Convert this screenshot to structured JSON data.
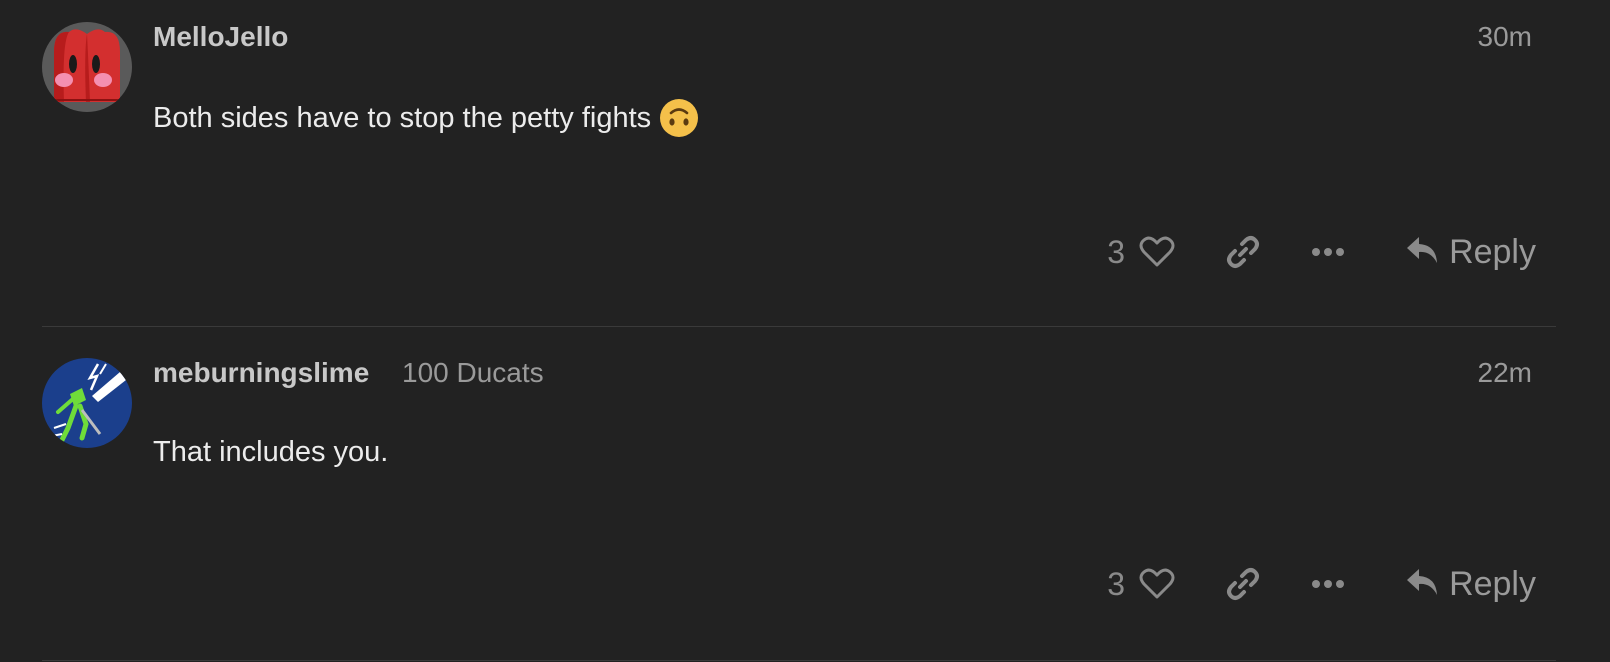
{
  "posts": [
    {
      "username": "MelloJello",
      "flair": "",
      "timestamp": "30m",
      "body": "Both sides have to stop the petty fights",
      "emoji": "upside-down-face",
      "like_count": "3",
      "reply_label": "Reply",
      "avatar_colors": {
        "background": "#5a5a5a",
        "figure": "#d32f2f",
        "cheeks": "#f48fb1"
      }
    },
    {
      "username": "meburningslime",
      "flair": "100 Ducats",
      "timestamp": "22m",
      "body": "That includes you.",
      "emoji": "",
      "like_count": "3",
      "reply_label": "Reply",
      "avatar_colors": {
        "background": "#1b3f8c",
        "figure": "#6fdc3a"
      }
    }
  ],
  "icons": {
    "like": "heart-icon",
    "share": "link-icon",
    "more": "ellipsis-icon",
    "reply": "reply-arrow-icon"
  },
  "colors": {
    "page_background": "#222222",
    "username": "#c8c8c8",
    "muted_text": "#9a9a9a",
    "body_text": "#ececec",
    "divider": "#3a3a3a"
  }
}
